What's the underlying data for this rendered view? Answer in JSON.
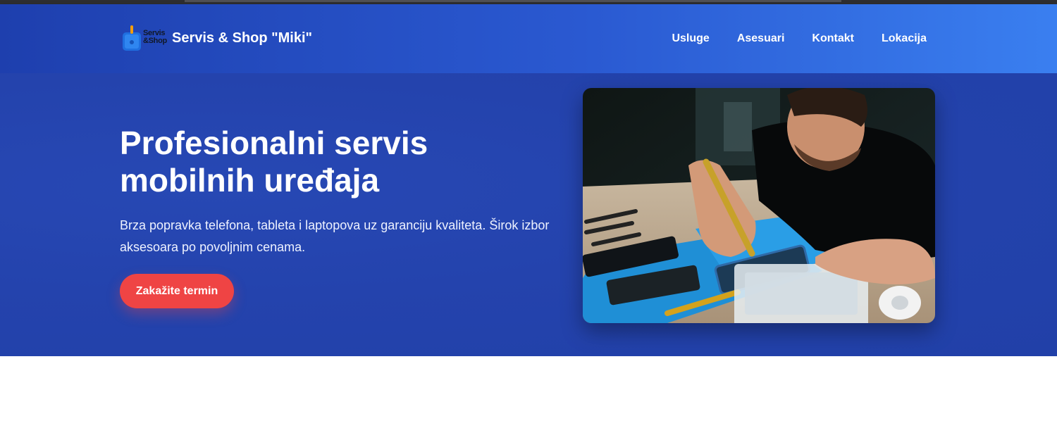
{
  "header": {
    "logo": {
      "line1": "Servis",
      "line2": "&Shop"
    },
    "brand_name": "Servis & Shop \"Miki\"",
    "nav": [
      {
        "label": "Usluge"
      },
      {
        "label": "Asesuari"
      },
      {
        "label": "Kontakt"
      },
      {
        "label": "Lokacija"
      }
    ]
  },
  "hero": {
    "title": "Profesionalni servis mobilnih uređaja",
    "description": "Brza popravka telefona, tableta i laptopova uz garanciju kvaliteta. Širok izbor aksesoara po povoljnim cenama.",
    "cta_label": "Zakažite termin",
    "image_alt": "technician repairing smartphones"
  },
  "colors": {
    "header_start": "#1e3fae",
    "header_end": "#3a7ff0",
    "hero_bg": "#2443ad",
    "cta": "#ef4444",
    "text": "#ffffff"
  }
}
